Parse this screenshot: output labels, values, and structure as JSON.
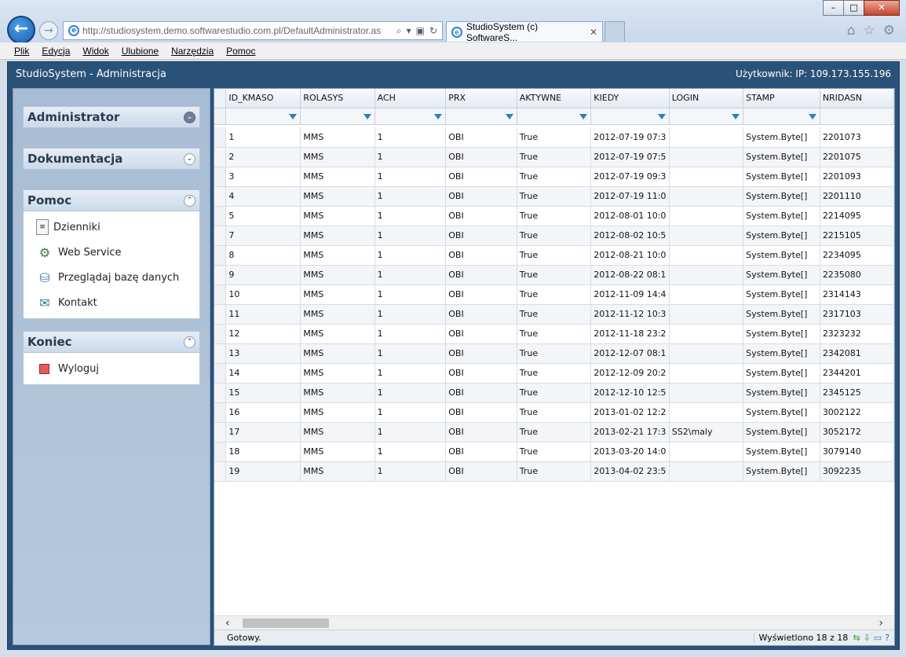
{
  "browser": {
    "url": "http://studiosystem.demo.softwarestudio.com.pl/DefaultAdministrator.as",
    "tab_title": "StudioSystem (c) SoftwareS...",
    "menu": [
      "Plik",
      "Edycja",
      "Widok",
      "Ulubione",
      "Narzędzia",
      "Pomoc"
    ]
  },
  "app": {
    "title": "StudioSystem - Administracja",
    "user": "Użytkownik: IP: 109.173.155.196"
  },
  "sidebar": {
    "panels": [
      {
        "title": "Administrator",
        "items": []
      },
      {
        "title": "Dokumentacja",
        "items": []
      },
      {
        "title": "Pomoc",
        "items": [
          {
            "label": "Dzienniki",
            "icon": "log-icon"
          },
          {
            "label": "Web Service",
            "icon": "web-service-icon"
          },
          {
            "label": "Przeglądaj bazę danych",
            "icon": "database-icon"
          },
          {
            "label": "Kontakt",
            "icon": "contact-icon"
          }
        ]
      },
      {
        "title": "Koniec",
        "items": [
          {
            "label": "Wyloguj",
            "icon": "logout-icon"
          }
        ]
      }
    ]
  },
  "grid": {
    "columns": [
      "ID_KMASO",
      "ROLASYS",
      "ACH",
      "PRX",
      "AKTYWNE",
      "KIEDY",
      "LOGIN",
      "STAMP",
      "NRIDASN"
    ],
    "rows": [
      [
        "1",
        "MMS",
        "1",
        "OBI",
        "True",
        "2012-07-19 07:3",
        "",
        "System.Byte[]",
        "2201073"
      ],
      [
        "2",
        "MMS",
        "1",
        "OBI",
        "True",
        "2012-07-19 07:5",
        "",
        "System.Byte[]",
        "2201075"
      ],
      [
        "3",
        "MMS",
        "1",
        "OBI",
        "True",
        "2012-07-19 09:3",
        "",
        "System.Byte[]",
        "2201093"
      ],
      [
        "4",
        "MMS",
        "1",
        "OBI",
        "True",
        "2012-07-19 11:0",
        "",
        "System.Byte[]",
        "2201110"
      ],
      [
        "5",
        "MMS",
        "1",
        "OBI",
        "True",
        "2012-08-01 10:0",
        "",
        "System.Byte[]",
        "2214095"
      ],
      [
        "7",
        "MMS",
        "1",
        "OBI",
        "True",
        "2012-08-02 10:5",
        "",
        "System.Byte[]",
        "2215105"
      ],
      [
        "8",
        "MMS",
        "1",
        "OBI",
        "True",
        "2012-08-21 10:0",
        "",
        "System.Byte[]",
        "2234095"
      ],
      [
        "9",
        "MMS",
        "1",
        "OBI",
        "True",
        "2012-08-22 08:1",
        "",
        "System.Byte[]",
        "2235080"
      ],
      [
        "10",
        "MMS",
        "1",
        "OBI",
        "True",
        "2012-11-09 14:4",
        "",
        "System.Byte[]",
        "2314143"
      ],
      [
        "11",
        "MMS",
        "1",
        "OBI",
        "True",
        "2012-11-12 10:3",
        "",
        "System.Byte[]",
        "2317103"
      ],
      [
        "12",
        "MMS",
        "1",
        "OBI",
        "True",
        "2012-11-18 23:2",
        "",
        "System.Byte[]",
        "2323232"
      ],
      [
        "13",
        "MMS",
        "1",
        "OBI",
        "True",
        "2012-12-07 08:1",
        "",
        "System.Byte[]",
        "2342081"
      ],
      [
        "14",
        "MMS",
        "1",
        "OBI",
        "True",
        "2012-12-09 20:2",
        "",
        "System.Byte[]",
        "2344201"
      ],
      [
        "15",
        "MMS",
        "1",
        "OBI",
        "True",
        "2012-12-10 12:5",
        "",
        "System.Byte[]",
        "2345125"
      ],
      [
        "16",
        "MMS",
        "1",
        "OBI",
        "True",
        "2013-01-02 12:2",
        "",
        "System.Byte[]",
        "3002122"
      ],
      [
        "17",
        "MMS",
        "1",
        "OBI",
        "True",
        "2013-02-21 17:3",
        "SS2\\maly",
        "System.Byte[]",
        "3052172"
      ],
      [
        "18",
        "MMS",
        "1",
        "OBI",
        "True",
        "2013-03-20 14:0",
        "",
        "System.Byte[]",
        "3079140"
      ],
      [
        "19",
        "MMS",
        "1",
        "OBI",
        "True",
        "2013-04-02 23:5",
        "",
        "System.Byte[]",
        "3092235"
      ]
    ]
  },
  "status": {
    "text": "Gotowy.",
    "count": "Wyświetlono 18 z 18"
  }
}
